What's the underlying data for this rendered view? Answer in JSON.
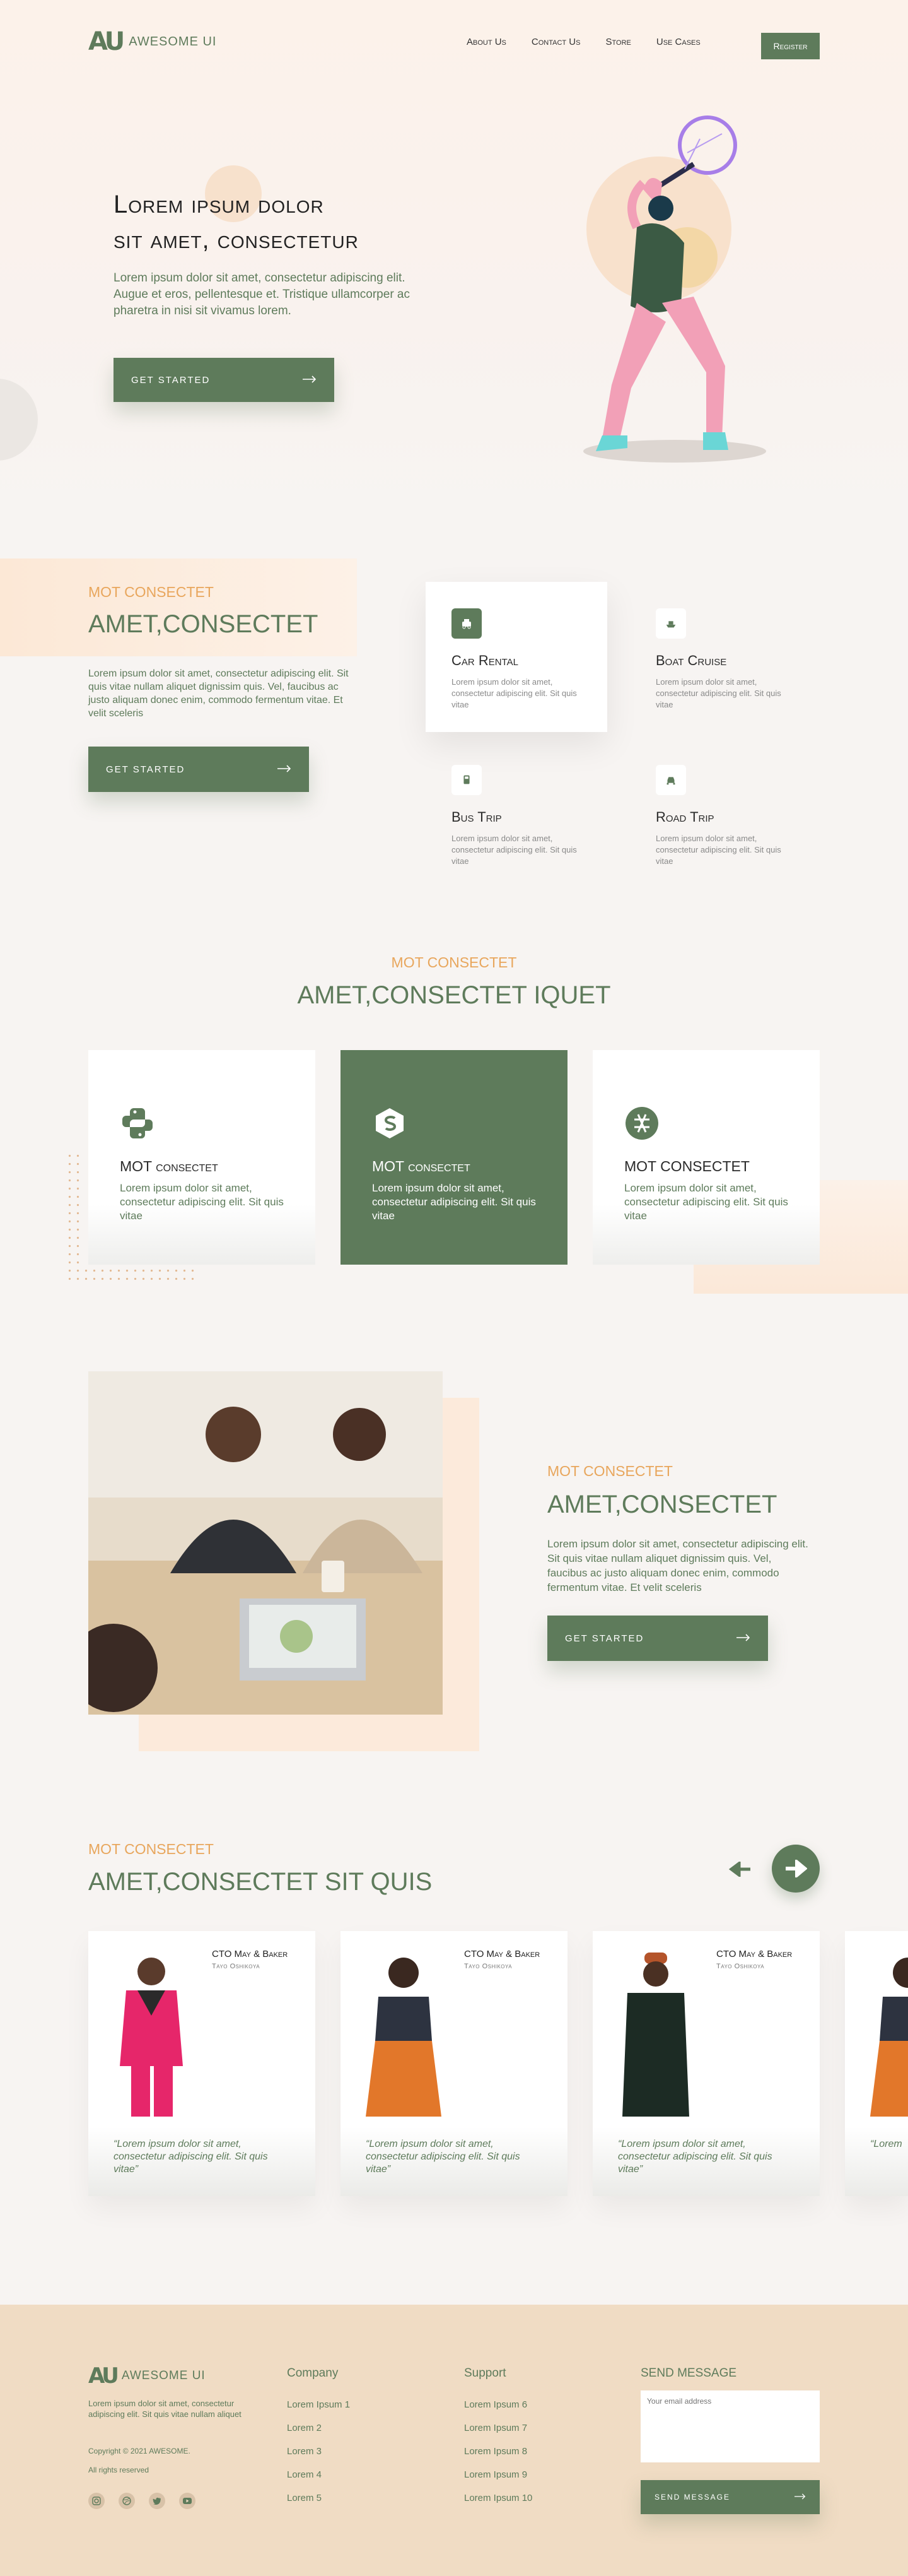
{
  "header": {
    "logo_mark": "AU",
    "logo_text": "AWESOME UI",
    "nav": [
      "About Us",
      "Contact Us",
      "Store",
      "Use Cases"
    ],
    "register_label": "Register"
  },
  "hero": {
    "title_line1": "Lorem ipsum dolor",
    "title_line2": "sit amet, consectetur",
    "text": "Lorem ipsum dolor sit amet, consectetur adipiscing elit. Augue et eros, pellentesque et. Tristique ullamcorper ac pharetra in nisi sit vivamus lorem.",
    "cta": "GET STARTED"
  },
  "services": {
    "eyebrow": "MOT CONSECTET",
    "title": "AMET,CONSECTET",
    "text": "Lorem ipsum dolor sit amet, consectetur adipiscing elit. Sit quis vitae nullam aliquet dignissim quis. Vel, faucibus ac justo aliquam donec enim, commodo fermentum vitae. Et velit sceleris",
    "cta": "GET STARTED",
    "items": [
      {
        "title": "Car Rental",
        "text": "Lorem ipsum dolor sit amet, consectetur adipiscing elit. Sit quis vitae"
      },
      {
        "title": "Boat Cruise",
        "text": "Lorem ipsum dolor sit amet, consectetur adipiscing elit. Sit quis vitae"
      },
      {
        "title": "Bus Trip",
        "text": "Lorem ipsum dolor sit amet, consectetur adipiscing elit. Sit quis vitae"
      },
      {
        "title": "Road Trip",
        "text": "Lorem ipsum dolor sit amet, consectetur adipiscing elit. Sit quis vitae"
      }
    ]
  },
  "features": {
    "eyebrow": "MOT CONSECTET",
    "title": "AMET,CONSECTET IQUET",
    "cards": [
      {
        "title": "MOT consectet",
        "text": "Lorem ipsum dolor sit amet, consectetur adipiscing elit. Sit quis vitae"
      },
      {
        "title": "MOT consectet",
        "text": "Lorem ipsum dolor sit amet, consectetur adipiscing elit. Sit quis vitae"
      },
      {
        "title": "MOT CONSECTET",
        "text": "Lorem ipsum dolor sit amet, consectetur adipiscing elit. Sit quis vitae"
      }
    ]
  },
  "about": {
    "eyebrow": "MOT CONSECTET",
    "title": "AMET,CONSECTET",
    "text": "Lorem ipsum dolor sit amet, consectetur adipiscing elit. Sit quis vitae nullam aliquet dignissim quis. Vel, faucibus ac justo aliquam donec enim, commodo fermentum vitae. Et velit sceleris",
    "cta": "GET STARTED"
  },
  "testimonials": {
    "eyebrow": "MOT CONSECTET",
    "title": "AMET,CONSECTET SIT QUIS",
    "cards": [
      {
        "role": "CTO May & Baker",
        "name": "Tayo Oshikoya",
        "quote": "“Lorem ipsum dolor sit amet, consectetur adipiscing elit. Sit quis vitae”"
      },
      {
        "role": "CTO May & Baker",
        "name": "Tayo Oshikoya",
        "quote": "“Lorem ipsum dolor sit amet, consectetur adipiscing elit. Sit quis vitae”"
      },
      {
        "role": "CTO May & Baker",
        "name": "Tayo Oshikoya",
        "quote": "“Lorem ipsum dolor sit amet, consectetur adipiscing elit. Sit quis vitae”"
      },
      {
        "quote": "“Lorem"
      }
    ]
  },
  "footer": {
    "logo_mark": "AU",
    "logo_text": "AWESOME UI",
    "about": "Lorem ipsum dolor sit amet, consectetur adipiscing elit. Sit quis vitae nullam aliquet",
    "copyright": "Copyright © 2021 AWESOME.",
    "rights": "All rights reserved",
    "company_title": "Company",
    "company_links": [
      "Lorem Ipsum 1",
      "Lorem  2",
      "Lorem  3",
      "Lorem  4",
      "Lorem  5"
    ],
    "support_title": "Support",
    "support_links": [
      "Lorem Ipsum 6",
      "Lorem Ipsum 7",
      "Lorem Ipsum 8",
      "Lorem Ipsum 9",
      "Lorem Ipsum 10"
    ],
    "message_title": "SEND MESSAGE",
    "email_placeholder": "Your email address",
    "send_label": "SEND MESSAGE",
    "social": [
      "instagram-icon",
      "dribbble-icon",
      "twitter-icon",
      "youtube-icon"
    ]
  },
  "colors": {
    "primary": "#5e7b5b",
    "accent": "#e8a65c",
    "footer_bg": "#f0dcc4"
  }
}
